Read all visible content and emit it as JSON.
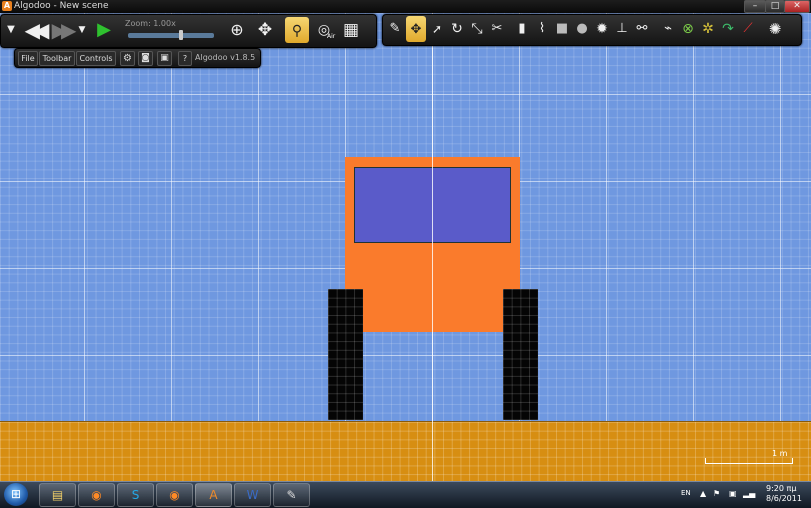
{
  "window": {
    "title": "Algodoo - New scene",
    "logo_letter": "A",
    "minimize": "–",
    "maximize": "□",
    "close": "✕"
  },
  "sim_toolbar": {
    "zoom_label": "Zoom: 1.00x",
    "zoom_value": 1.0,
    "air_label": "Air",
    "icons": [
      "menu-arrow-icon",
      "rewind-icon",
      "fast-forward-icon",
      "dropdown-icon",
      "play-icon",
      "zoom-icon",
      "move-icon",
      "gravity-icon",
      "air-icon",
      "grid-icon"
    ]
  },
  "menu_bar": {
    "file": "File",
    "toolbar": "Toolbar",
    "controls": "Controls",
    "about": "?",
    "version": "Algodoo v1.8.5"
  },
  "tools_toolbar": {
    "icons": [
      "sketch-icon",
      "move-tool-icon",
      "drag-icon",
      "rotate-icon",
      "scale-icon",
      "cut-icon",
      "plane-icon",
      "brush-icon",
      "box-icon",
      "circle-icon",
      "gear-icon",
      "fixate-icon",
      "hinge-icon",
      "spring-icon",
      "axle-icon",
      "thruster-icon",
      "tracer-icon",
      "laser-icon",
      "chain-icon"
    ],
    "selected": "move-tool-icon"
  },
  "scene": {
    "scale_label": "1 m",
    "colors": {
      "sky": "#6f98e0",
      "ground": "#d78e12",
      "vehicle_body": "#fa7b2c",
      "window": "#5a5bc9",
      "wheels": "#050505"
    }
  },
  "taskbar": {
    "apps": [
      "explorer-icon",
      "firefox-icon",
      "skype-icon",
      "firefox-icon",
      "algodoo-icon",
      "word-icon",
      "paint-icon"
    ],
    "language": "EN",
    "time": "9:20 πμ",
    "date": "8/6/2011"
  }
}
